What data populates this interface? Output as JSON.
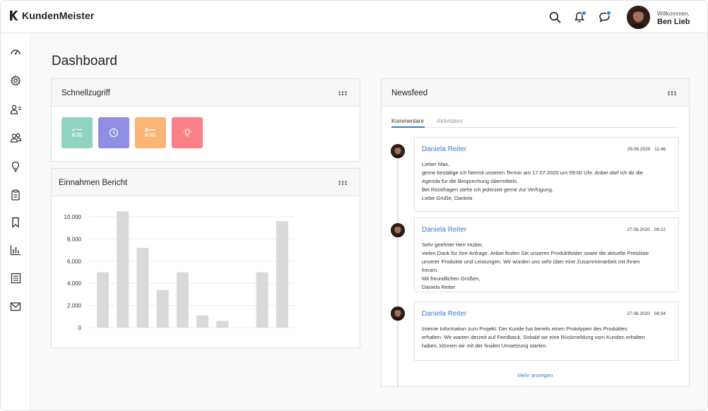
{
  "app": {
    "name": "KundenMeister"
  },
  "header": {
    "greeting": "Willkommen,",
    "user_name": "Ben Lieb",
    "notification_color": "#2f7ef5"
  },
  "sidebar": {
    "items": [
      {
        "icon": "dashboard-icon"
      },
      {
        "icon": "gear-icon"
      },
      {
        "icon": "user-list-icon"
      },
      {
        "icon": "users-icon"
      },
      {
        "icon": "lightbulb-icon"
      },
      {
        "icon": "clipboard-icon"
      },
      {
        "icon": "bookmark-icon"
      },
      {
        "icon": "bar-chart-icon"
      },
      {
        "icon": "document-list-icon"
      },
      {
        "icon": "mail-icon"
      }
    ]
  },
  "page": {
    "title": "Dashboard"
  },
  "quick_access": {
    "title": "Schnellzugriff",
    "buttons": [
      {
        "icon": "checklist-icon",
        "color": "#8fd3c0"
      },
      {
        "icon": "clock-icon",
        "color": "#8f8ee3"
      },
      {
        "icon": "list-icon",
        "color": "#fbb676"
      },
      {
        "icon": "lightbulb-icon",
        "color": "#fb8189"
      }
    ]
  },
  "income_report": {
    "title": "Einnahmen Bericht"
  },
  "chart_data": {
    "type": "bar",
    "title": "Einnahmen Bericht",
    "categories": [
      "",
      "",
      "",
      "",
      "",
      "",
      "",
      "",
      "",
      ""
    ],
    "values": [
      5000,
      10600,
      7200,
      3400,
      5000,
      1100,
      600,
      0,
      5000,
      9600
    ],
    "ylim": [
      0,
      10000
    ],
    "yticks": [
      "0",
      "2.000",
      "4.000",
      "6.000",
      "8.000",
      "10.000"
    ],
    "grid": true,
    "bar_color": "#d9d9d9"
  },
  "newsfeed": {
    "title": "Newsfeed",
    "tabs": [
      "Kommentare",
      "Aktivitäten"
    ],
    "active_tab": "Kommentare",
    "items": [
      {
        "author": "Daniela Reiter",
        "date": "29.06.2020",
        "time": "11:46",
        "lines": [
          "Lieber Max,",
          "gerne bestätige ich hiermit unseren Termin am 17.07.2020 um 09:00 Uhr. Anbei darf ich dir die",
          "Agenda für die Besprechung übermitteln.",
          "Bei Rückfragen stehe ich jederzeit gerne zur Verfügung.",
          "Liebe Grüße, Daniela"
        ]
      },
      {
        "author": "Daniela Reiter",
        "date": "27.06.2020",
        "time": "09:22",
        "lines": [
          "Sehr geehrter Herr Huber,",
          "vielen Dank für Ihre Anfrage. Anbei finden Sie unseren Produktfolder sowie die aktuelle Preisliste",
          "unserer Produkte und Leistungen. Wir würden uns sehr über eine Zusammenarbeit mit Ihnen",
          "freuen.",
          "Mit freundlichen Grüßen,",
          "Daniela Reiter"
        ]
      },
      {
        "author": "Daniela Reiter",
        "date": "27.06.2020",
        "time": "08:34",
        "lines": [
          "Interne Information zum Projekt: Der Kunde hat bereits einen Prototypen des Produktes",
          "erhalten. Wir warten derzeit auf Feedback. Sobald wir eine Rückmeldung vom Kunden erhalten",
          "haben, können wir mit der finalen Umsetzung starten."
        ]
      }
    ],
    "more_label": "Mehr anzeigen"
  }
}
